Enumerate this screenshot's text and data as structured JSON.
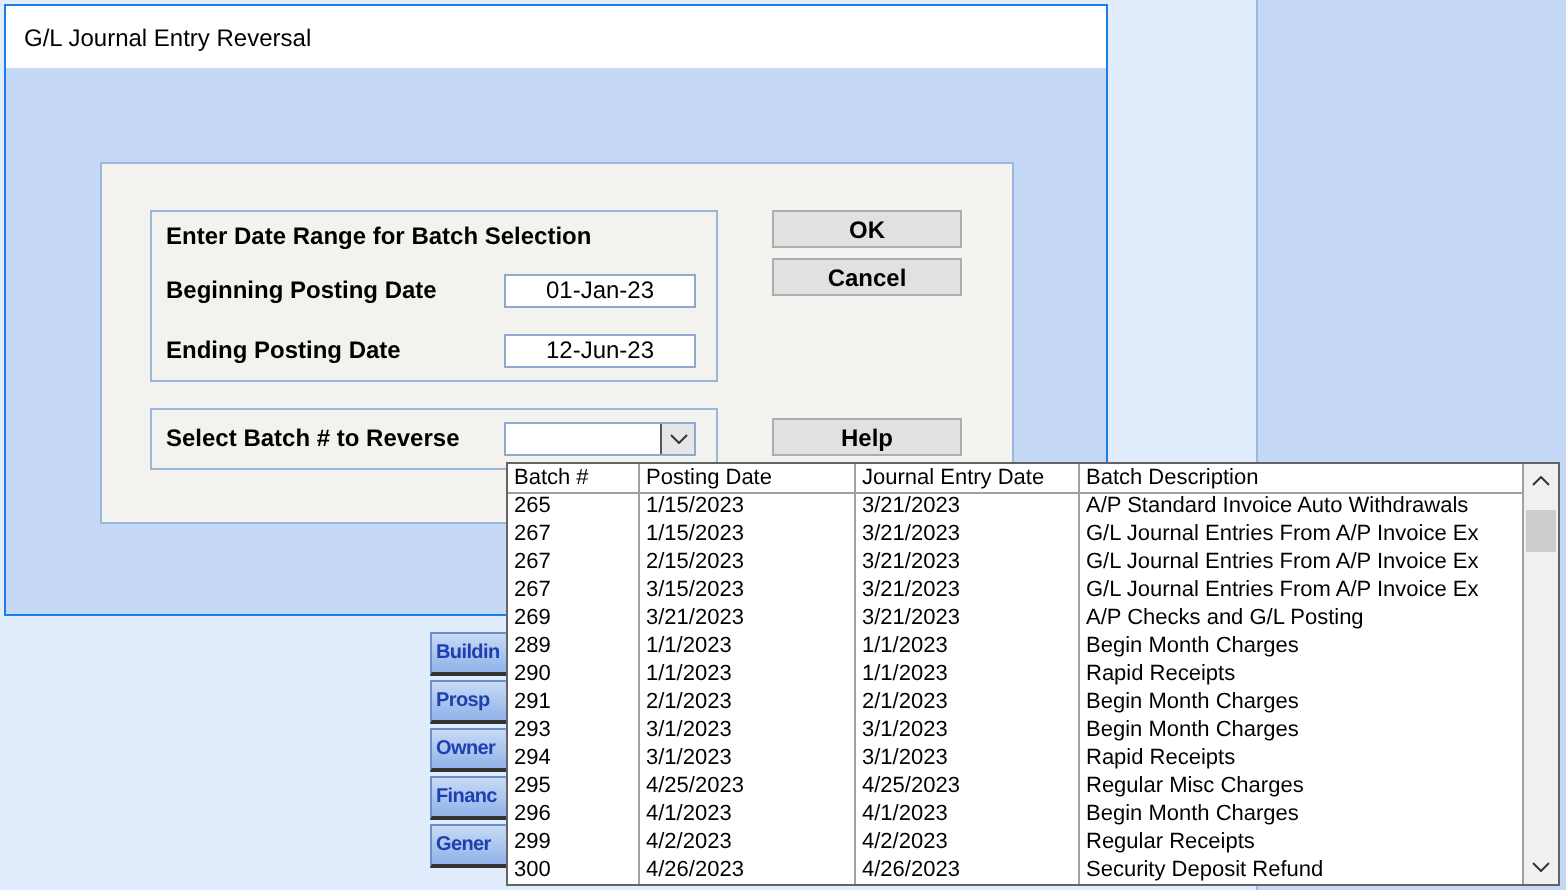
{
  "window": {
    "title": "G/L Journal Entry Reversal"
  },
  "date_range": {
    "heading": "Enter Date Range for Batch Selection",
    "fields": [
      {
        "label": "Beginning Posting Date",
        "value": "01-Jan-23"
      },
      {
        "label": "Ending Posting Date",
        "value": "12-Jun-23"
      }
    ]
  },
  "batch_select": {
    "label": "Select Batch # to Reverse"
  },
  "buttons": [
    "OK",
    "Cancel",
    "Help"
  ],
  "sidebar": {
    "items": [
      "Buildin",
      "Prosp",
      "Owner",
      "Financ",
      "Gener"
    ]
  },
  "dropdown": {
    "columns": [
      "Batch #",
      "Posting Date",
      "Journal Entry Date",
      "Batch Description"
    ],
    "rows": [
      [
        "265",
        "1/15/2023",
        "3/21/2023",
        "A/P Standard Invoice Auto Withdrawals"
      ],
      [
        "267",
        "1/15/2023",
        "3/21/2023",
        "G/L Journal Entries From A/P Invoice Ex"
      ],
      [
        "267",
        "2/15/2023",
        "3/21/2023",
        "G/L Journal Entries From A/P Invoice Ex"
      ],
      [
        "267",
        "3/15/2023",
        "3/21/2023",
        "G/L Journal Entries From A/P Invoice Ex"
      ],
      [
        "269",
        "3/21/2023",
        "3/21/2023",
        "A/P Checks and G/L Posting"
      ],
      [
        "289",
        "1/1/2023",
        "1/1/2023",
        "Begin Month Charges"
      ],
      [
        "290",
        "1/1/2023",
        "1/1/2023",
        "Rapid Receipts"
      ],
      [
        "291",
        "2/1/2023",
        "2/1/2023",
        "Begin Month Charges"
      ],
      [
        "293",
        "3/1/2023",
        "3/1/2023",
        "Begin Month Charges"
      ],
      [
        "294",
        "3/1/2023",
        "3/1/2023",
        "Rapid Receipts"
      ],
      [
        "295",
        "4/25/2023",
        "4/25/2023",
        "Regular Misc Charges"
      ],
      [
        "296",
        "4/1/2023",
        "4/1/2023",
        "Begin Month Charges"
      ],
      [
        "299",
        "4/2/2023",
        "4/2/2023",
        "Regular Receipts"
      ],
      [
        "300",
        "4/26/2023",
        "4/26/2023",
        "Security Deposit Refund"
      ]
    ]
  }
}
